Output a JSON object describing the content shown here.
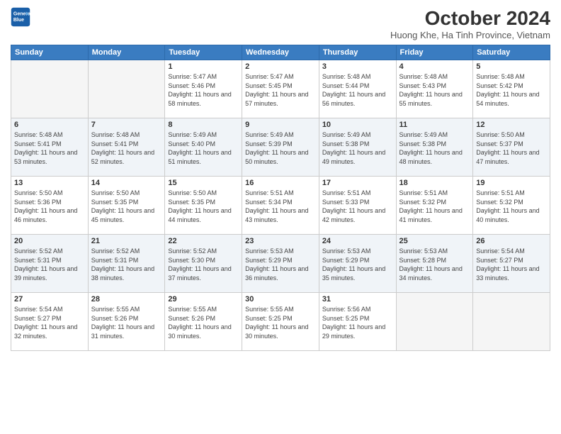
{
  "header": {
    "logo_line1": "General",
    "logo_line2": "Blue",
    "title": "October 2024",
    "location": "Huong Khe, Ha Tinh Province, Vietnam"
  },
  "days_of_week": [
    "Sunday",
    "Monday",
    "Tuesday",
    "Wednesday",
    "Thursday",
    "Friday",
    "Saturday"
  ],
  "weeks": [
    [
      {
        "num": "",
        "sunrise": "",
        "sunset": "",
        "daylight": ""
      },
      {
        "num": "",
        "sunrise": "",
        "sunset": "",
        "daylight": ""
      },
      {
        "num": "1",
        "sunrise": "Sunrise: 5:47 AM",
        "sunset": "Sunset: 5:46 PM",
        "daylight": "Daylight: 11 hours and 58 minutes."
      },
      {
        "num": "2",
        "sunrise": "Sunrise: 5:47 AM",
        "sunset": "Sunset: 5:45 PM",
        "daylight": "Daylight: 11 hours and 57 minutes."
      },
      {
        "num": "3",
        "sunrise": "Sunrise: 5:48 AM",
        "sunset": "Sunset: 5:44 PM",
        "daylight": "Daylight: 11 hours and 56 minutes."
      },
      {
        "num": "4",
        "sunrise": "Sunrise: 5:48 AM",
        "sunset": "Sunset: 5:43 PM",
        "daylight": "Daylight: 11 hours and 55 minutes."
      },
      {
        "num": "5",
        "sunrise": "Sunrise: 5:48 AM",
        "sunset": "Sunset: 5:42 PM",
        "daylight": "Daylight: 11 hours and 54 minutes."
      }
    ],
    [
      {
        "num": "6",
        "sunrise": "Sunrise: 5:48 AM",
        "sunset": "Sunset: 5:41 PM",
        "daylight": "Daylight: 11 hours and 53 minutes."
      },
      {
        "num": "7",
        "sunrise": "Sunrise: 5:48 AM",
        "sunset": "Sunset: 5:41 PM",
        "daylight": "Daylight: 11 hours and 52 minutes."
      },
      {
        "num": "8",
        "sunrise": "Sunrise: 5:49 AM",
        "sunset": "Sunset: 5:40 PM",
        "daylight": "Daylight: 11 hours and 51 minutes."
      },
      {
        "num": "9",
        "sunrise": "Sunrise: 5:49 AM",
        "sunset": "Sunset: 5:39 PM",
        "daylight": "Daylight: 11 hours and 50 minutes."
      },
      {
        "num": "10",
        "sunrise": "Sunrise: 5:49 AM",
        "sunset": "Sunset: 5:38 PM",
        "daylight": "Daylight: 11 hours and 49 minutes."
      },
      {
        "num": "11",
        "sunrise": "Sunrise: 5:49 AM",
        "sunset": "Sunset: 5:38 PM",
        "daylight": "Daylight: 11 hours and 48 minutes."
      },
      {
        "num": "12",
        "sunrise": "Sunrise: 5:50 AM",
        "sunset": "Sunset: 5:37 PM",
        "daylight": "Daylight: 11 hours and 47 minutes."
      }
    ],
    [
      {
        "num": "13",
        "sunrise": "Sunrise: 5:50 AM",
        "sunset": "Sunset: 5:36 PM",
        "daylight": "Daylight: 11 hours and 46 minutes."
      },
      {
        "num": "14",
        "sunrise": "Sunrise: 5:50 AM",
        "sunset": "Sunset: 5:35 PM",
        "daylight": "Daylight: 11 hours and 45 minutes."
      },
      {
        "num": "15",
        "sunrise": "Sunrise: 5:50 AM",
        "sunset": "Sunset: 5:35 PM",
        "daylight": "Daylight: 11 hours and 44 minutes."
      },
      {
        "num": "16",
        "sunrise": "Sunrise: 5:51 AM",
        "sunset": "Sunset: 5:34 PM",
        "daylight": "Daylight: 11 hours and 43 minutes."
      },
      {
        "num": "17",
        "sunrise": "Sunrise: 5:51 AM",
        "sunset": "Sunset: 5:33 PM",
        "daylight": "Daylight: 11 hours and 42 minutes."
      },
      {
        "num": "18",
        "sunrise": "Sunrise: 5:51 AM",
        "sunset": "Sunset: 5:32 PM",
        "daylight": "Daylight: 11 hours and 41 minutes."
      },
      {
        "num": "19",
        "sunrise": "Sunrise: 5:51 AM",
        "sunset": "Sunset: 5:32 PM",
        "daylight": "Daylight: 11 hours and 40 minutes."
      }
    ],
    [
      {
        "num": "20",
        "sunrise": "Sunrise: 5:52 AM",
        "sunset": "Sunset: 5:31 PM",
        "daylight": "Daylight: 11 hours and 39 minutes."
      },
      {
        "num": "21",
        "sunrise": "Sunrise: 5:52 AM",
        "sunset": "Sunset: 5:31 PM",
        "daylight": "Daylight: 11 hours and 38 minutes."
      },
      {
        "num": "22",
        "sunrise": "Sunrise: 5:52 AM",
        "sunset": "Sunset: 5:30 PM",
        "daylight": "Daylight: 11 hours and 37 minutes."
      },
      {
        "num": "23",
        "sunrise": "Sunrise: 5:53 AM",
        "sunset": "Sunset: 5:29 PM",
        "daylight": "Daylight: 11 hours and 36 minutes."
      },
      {
        "num": "24",
        "sunrise": "Sunrise: 5:53 AM",
        "sunset": "Sunset: 5:29 PM",
        "daylight": "Daylight: 11 hours and 35 minutes."
      },
      {
        "num": "25",
        "sunrise": "Sunrise: 5:53 AM",
        "sunset": "Sunset: 5:28 PM",
        "daylight": "Daylight: 11 hours and 34 minutes."
      },
      {
        "num": "26",
        "sunrise": "Sunrise: 5:54 AM",
        "sunset": "Sunset: 5:27 PM",
        "daylight": "Daylight: 11 hours and 33 minutes."
      }
    ],
    [
      {
        "num": "27",
        "sunrise": "Sunrise: 5:54 AM",
        "sunset": "Sunset: 5:27 PM",
        "daylight": "Daylight: 11 hours and 32 minutes."
      },
      {
        "num": "28",
        "sunrise": "Sunrise: 5:55 AM",
        "sunset": "Sunset: 5:26 PM",
        "daylight": "Daylight: 11 hours and 31 minutes."
      },
      {
        "num": "29",
        "sunrise": "Sunrise: 5:55 AM",
        "sunset": "Sunset: 5:26 PM",
        "daylight": "Daylight: 11 hours and 30 minutes."
      },
      {
        "num": "30",
        "sunrise": "Sunrise: 5:55 AM",
        "sunset": "Sunset: 5:25 PM",
        "daylight": "Daylight: 11 hours and 30 minutes."
      },
      {
        "num": "31",
        "sunrise": "Sunrise: 5:56 AM",
        "sunset": "Sunset: 5:25 PM",
        "daylight": "Daylight: 11 hours and 29 minutes."
      },
      {
        "num": "",
        "sunrise": "",
        "sunset": "",
        "daylight": ""
      },
      {
        "num": "",
        "sunrise": "",
        "sunset": "",
        "daylight": ""
      }
    ]
  ]
}
